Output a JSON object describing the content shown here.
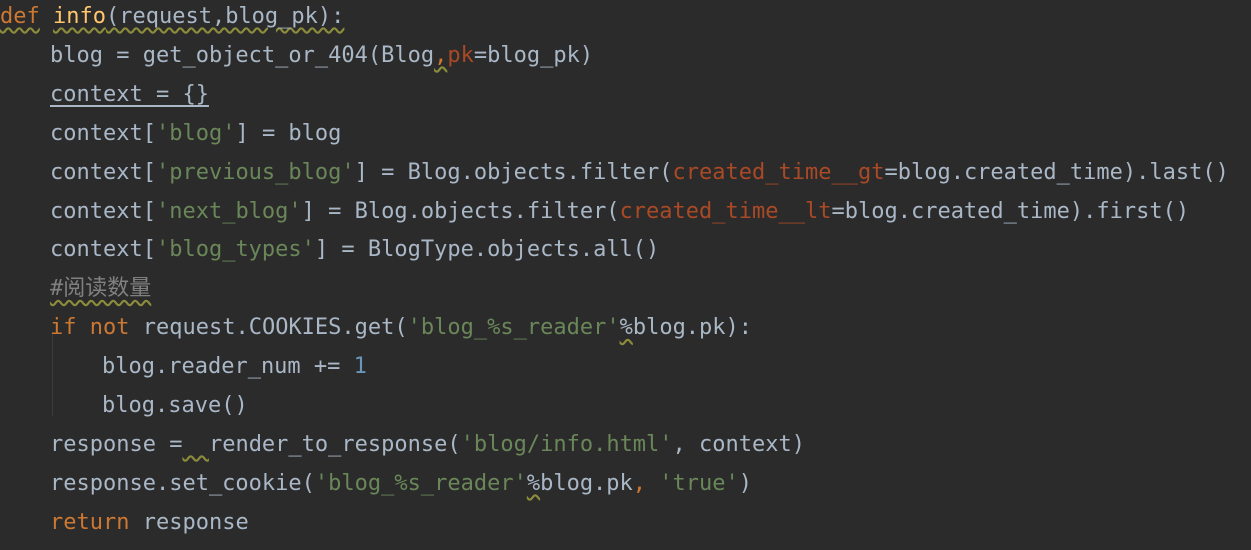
{
  "editor": {
    "colors": {
      "background": "#2b2b2b",
      "plain": "#a9b7c6",
      "keyword": "#cc7832",
      "function_def": "#ffc66d",
      "string": "#6a8759",
      "number": "#6897bb",
      "keyword_arg": "#aa4926",
      "comment": "#808080"
    },
    "lines": [
      {
        "tokens": [
          {
            "text": "def",
            "cls": "kw warn"
          },
          {
            "text": " ",
            "cls": "plain"
          },
          {
            "text": "info",
            "cls": "fn warn"
          },
          {
            "text": "(request,blog_pk):",
            "cls": "plain warn"
          }
        ]
      },
      {
        "tokens": [
          {
            "text": "blog = get_object_or_404(Blog",
            "cls": "plain"
          },
          {
            "text": ",",
            "cls": "kw warn"
          },
          {
            "text": "pk",
            "cls": "kwarg"
          },
          {
            "text": "=blog_pk)",
            "cls": "plain"
          }
        ]
      },
      {
        "tokens": [
          {
            "text": "context = {}",
            "cls": "plain uline"
          }
        ]
      },
      {
        "tokens": [
          {
            "text": "context[",
            "cls": "plain"
          },
          {
            "text": "'blog'",
            "cls": "str"
          },
          {
            "text": "] = blog",
            "cls": "plain"
          }
        ]
      },
      {
        "tokens": [
          {
            "text": "context[",
            "cls": "plain"
          },
          {
            "text": "'previous_blog'",
            "cls": "str"
          },
          {
            "text": "] = Blog.objects.filter(",
            "cls": "plain"
          },
          {
            "text": "created_time__gt",
            "cls": "kwarg"
          },
          {
            "text": "=blog.created_time).last()",
            "cls": "plain"
          }
        ]
      },
      {
        "tokens": [
          {
            "text": "context[",
            "cls": "plain"
          },
          {
            "text": "'next_blog'",
            "cls": "str"
          },
          {
            "text": "] = Blog.objects.filter(",
            "cls": "plain"
          },
          {
            "text": "created_time__lt",
            "cls": "kwarg"
          },
          {
            "text": "=blog.created_time).first()",
            "cls": "plain"
          }
        ]
      },
      {
        "tokens": [
          {
            "text": "context[",
            "cls": "plain"
          },
          {
            "text": "'blog_types'",
            "cls": "str"
          },
          {
            "text": "] = BlogType.objects.all()",
            "cls": "plain"
          }
        ]
      },
      {
        "tokens": [
          {
            "text": "#阅读数量",
            "cls": "cmt warn"
          }
        ]
      },
      {
        "tokens": [
          {
            "text": "if",
            "cls": "kw"
          },
          {
            "text": " ",
            "cls": "plain"
          },
          {
            "text": "not",
            "cls": "kw"
          },
          {
            "text": " request.COOKIES.get(",
            "cls": "plain"
          },
          {
            "text": "'blog_%s_reader'",
            "cls": "str"
          },
          {
            "text": "%",
            "cls": "plain warn"
          },
          {
            "text": "blog.pk):",
            "cls": "plain"
          }
        ]
      },
      {
        "tokens": [
          {
            "text": "blog.reader_num += ",
            "cls": "plain"
          },
          {
            "text": "1",
            "cls": "num"
          }
        ]
      },
      {
        "tokens": [
          {
            "text": "blog.save()",
            "cls": "plain"
          }
        ]
      },
      {
        "tokens": [
          {
            "text": "response =",
            "cls": "plain"
          },
          {
            "text": "  ",
            "cls": "plain warn"
          },
          {
            "text": "render_to_response(",
            "cls": "plain"
          },
          {
            "text": "'blog/info.html'",
            "cls": "str"
          },
          {
            "text": ", context)",
            "cls": "plain"
          }
        ]
      },
      {
        "tokens": [
          {
            "text": "response.set_cookie(",
            "cls": "plain"
          },
          {
            "text": "'blog_%s_reader'",
            "cls": "str"
          },
          {
            "text": "%",
            "cls": "plain warn"
          },
          {
            "text": "blog.pk",
            "cls": "plain"
          },
          {
            "text": ", ",
            "cls": "kw"
          },
          {
            "text": "'true'",
            "cls": "str"
          },
          {
            "text": ")",
            "cls": "plain"
          }
        ]
      },
      {
        "tokens": [
          {
            "text": "return",
            "cls": "kw"
          },
          {
            "text": " response",
            "cls": "plain"
          }
        ]
      }
    ]
  }
}
